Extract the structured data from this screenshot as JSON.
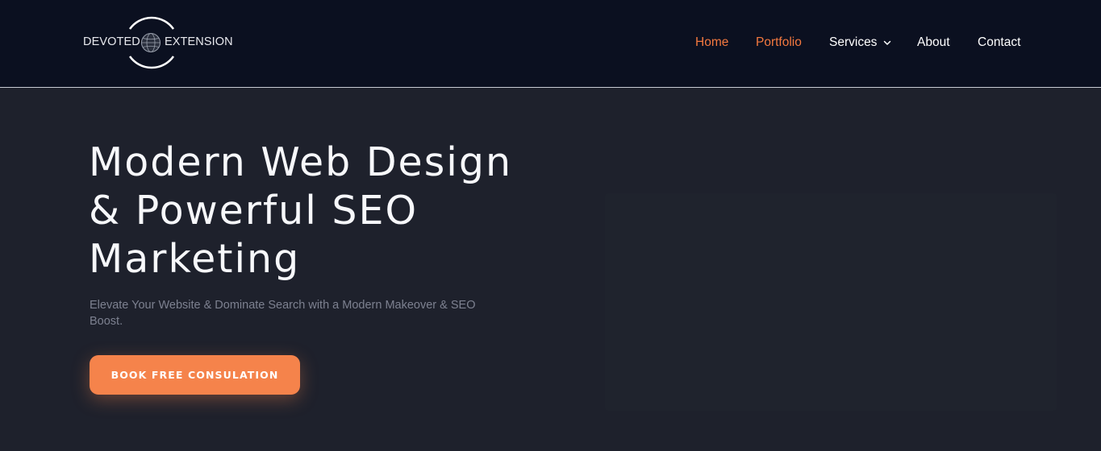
{
  "logo": {
    "left_word": "DEVOTED",
    "right_word": "EXTENSION",
    "icon": "globe-icon"
  },
  "nav": {
    "items": [
      {
        "label": "Home",
        "active": true
      },
      {
        "label": "Portfolio",
        "active": true
      },
      {
        "label": "Services",
        "active": false,
        "has_dropdown": true,
        "icon": "chevron-down-icon"
      },
      {
        "label": "About",
        "active": false
      },
      {
        "label": "Contact",
        "active": false
      }
    ]
  },
  "hero": {
    "title": "Modern Web Design & Powerful SEO Marketing",
    "subtitle": "Elevate Your Website & Dominate Search with a Modern Makeover & SEO Boost.",
    "cta_label": "BOOK FREE CONSULATION"
  },
  "colors": {
    "header_bg": "#0b1020",
    "page_bg": "#1e212c",
    "accent": "#f4793f",
    "button_bg": "#f5834b",
    "text": "#ffffff",
    "subtitle_text": "#7d8190"
  }
}
